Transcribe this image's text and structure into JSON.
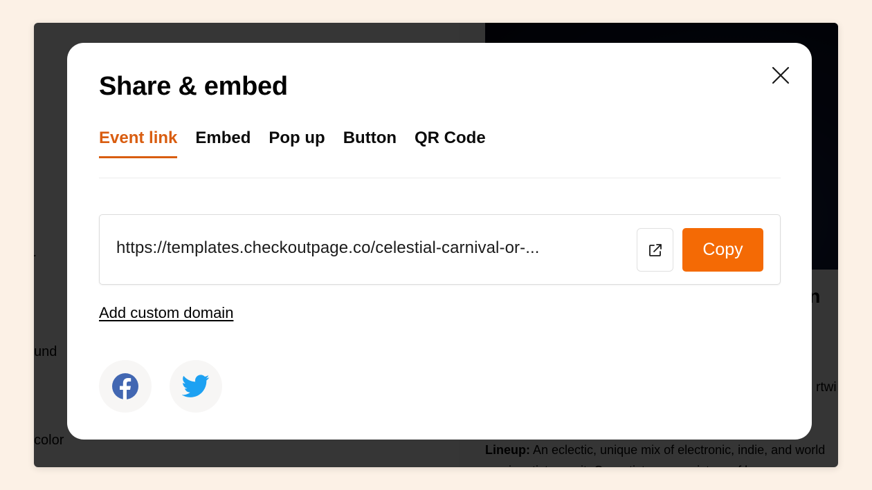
{
  "background": {
    "left_fragments": [
      "r",
      "und",
      "color"
    ],
    "right_heading_fragment": "erin",
    "right_para_fragment": "rtwi",
    "lineup_label": "Lineup:",
    "lineup_text": "An eclectic, unique mix of electronic, indie, and world music artists await. Our artists are a mixture of loc"
  },
  "modal": {
    "title": "Share & embed",
    "close_icon": "close-icon",
    "tabs": [
      {
        "label": "Event link",
        "active": true
      },
      {
        "label": "Embed",
        "active": false
      },
      {
        "label": "Pop up",
        "active": false
      },
      {
        "label": "Button",
        "active": false
      },
      {
        "label": "QR Code",
        "active": false
      }
    ],
    "event_link": {
      "url": "https://templates.checkoutpage.co/celestial-carnival-or-...",
      "open_icon": "external-link-icon",
      "copy_label": "Copy"
    },
    "custom_domain_label": "Add custom domain",
    "social": [
      {
        "name": "Facebook",
        "icon": "facebook-icon",
        "color": "#4267b2"
      },
      {
        "name": "Twitter",
        "icon": "twitter-icon",
        "color": "#1da1f2"
      }
    ]
  },
  "colors": {
    "accent": "#d95d10",
    "copy_button": "#f46a05",
    "page_background": "#fcf1e6"
  }
}
